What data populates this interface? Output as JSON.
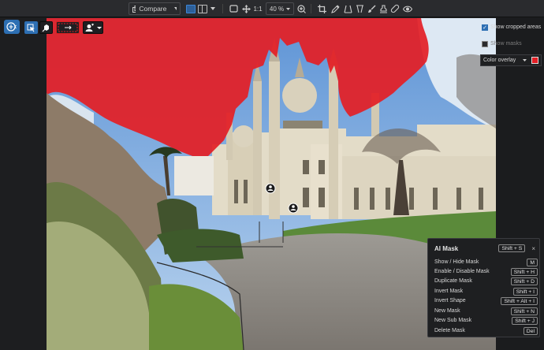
{
  "toolbar": {
    "compare_label": "Compare",
    "zoom_one_to_one": "1:1",
    "zoom_level": "40 %"
  },
  "right_panel": {
    "show_cropped_areas": "Show cropped areas",
    "show_cropped_checked": true,
    "show_masks": "Show masks",
    "show_masks_checked": false,
    "color_overlay_label": "Color overlay",
    "overlay_color": "#e31f26"
  },
  "shortcuts": {
    "title": "AI Mask",
    "title_key": "Shift + S",
    "close": "×",
    "items": [
      {
        "label": "Show / Hide Mask",
        "key": "M"
      },
      {
        "label": "Enable / Disable Mask",
        "key": "Shift + H"
      },
      {
        "label": "Duplicate Mask",
        "key": "Shift + D"
      },
      {
        "label": "Invert Mask",
        "key": "Shift + I"
      },
      {
        "label": "Invert Shape",
        "key": "Shift + Alt + I"
      },
      {
        "label": "New Mask",
        "key": "Shift + N"
      },
      {
        "label": "New Sub Mask",
        "key": "Shift + J"
      },
      {
        "label": "Delete Mask",
        "key": "Del"
      }
    ]
  },
  "colors": {
    "accent": "#2d6fb3",
    "mask_overlay": "#e31f26"
  }
}
